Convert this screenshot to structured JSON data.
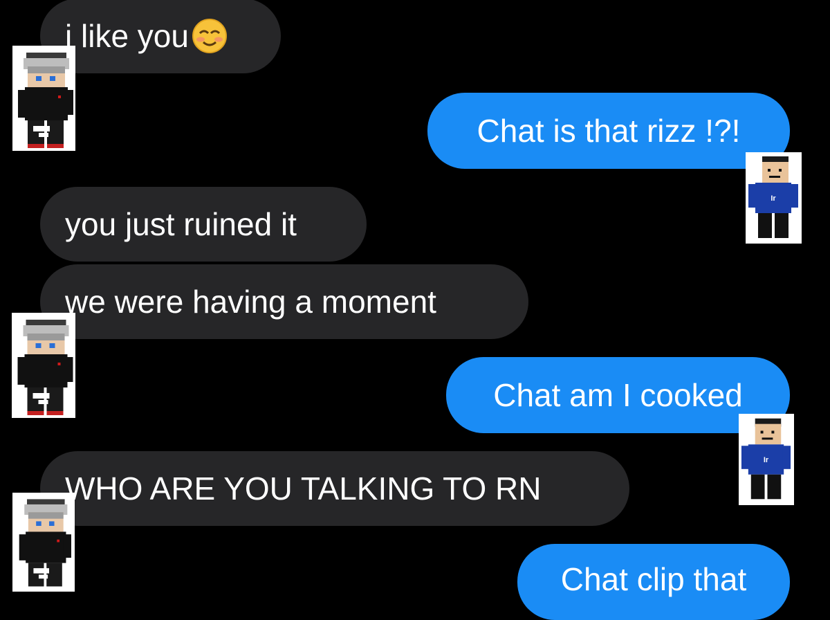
{
  "messages": [
    {
      "side": "received",
      "text": "i like you",
      "emoji": "smiling-face-icon"
    },
    {
      "side": "sent",
      "text": "Chat is that rizz !?!"
    },
    {
      "side": "received",
      "text": "you just ruined it"
    },
    {
      "side": "received",
      "text": "we were having a moment"
    },
    {
      "side": "sent",
      "text": "Chat am I cooked"
    },
    {
      "side": "received",
      "text": "WHO ARE YOU TALKING TO RN"
    },
    {
      "side": "sent",
      "text": "Chat clip that"
    }
  ],
  "avatars": {
    "left_character": "minecraft-boy-avatar-icon",
    "right_character": "minecraft-blue-hoodie-avatar-icon",
    "hoodie_text": "Ir"
  },
  "colors": {
    "background": "#000000",
    "received_bubble": "#262628",
    "sent_bubble": "#1a8cf5",
    "text": "#ffffff"
  }
}
